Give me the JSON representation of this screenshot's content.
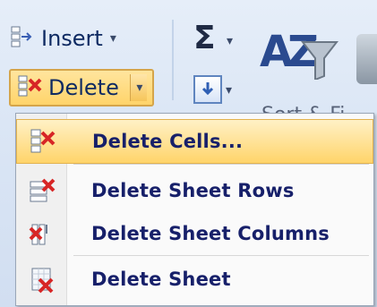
{
  "ribbon": {
    "insert_label": "Insert",
    "insert_caret": "▾",
    "delete_label": "Delete",
    "delete_caret": "▾",
    "sum_icon": "Σ",
    "sum_caret": "▾",
    "sort_icon_text": "AZ",
    "sort_label": "Sort & Fi"
  },
  "menu": {
    "items": [
      {
        "label": "Delete Cells...",
        "highlighted": true,
        "icon": "delete-cells-icon"
      },
      {
        "label": "Delete Sheet Rows",
        "highlighted": false,
        "icon": "delete-rows-icon"
      },
      {
        "label": "Delete Sheet Columns",
        "highlighted": false,
        "icon": "delete-columns-icon"
      },
      {
        "label": "Delete Sheet",
        "highlighted": false,
        "icon": "delete-sheet-icon"
      }
    ]
  },
  "colors": {
    "highlight": "#ffd46a",
    "menu_text": "#17206a",
    "delete_red": "#d72626"
  }
}
